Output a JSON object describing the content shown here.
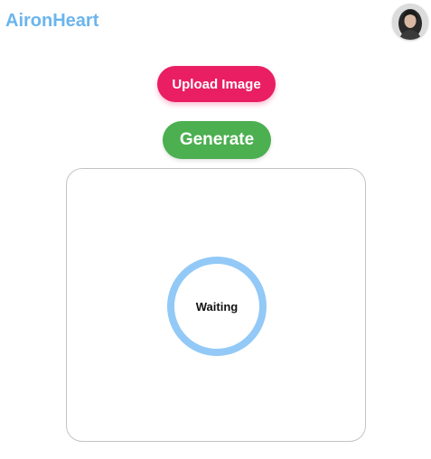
{
  "header": {
    "brand": "AironHeart",
    "avatar_icon": "user-avatar-photo"
  },
  "actions": {
    "upload_label": "Upload Image",
    "generate_label": "Generate"
  },
  "preview": {
    "status": "Waiting"
  },
  "colors": {
    "brand": "#6bb5ee",
    "upload_button": "#e91e63",
    "generate_button": "#4caf50",
    "spinner": "#92c9f6"
  }
}
